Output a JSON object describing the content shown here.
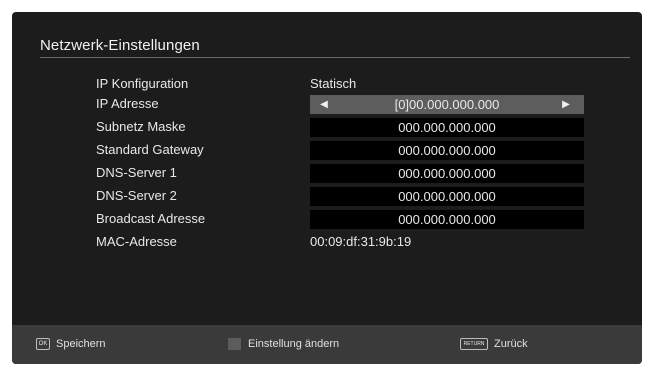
{
  "panel": {
    "title": "Netzwerk-Einstellungen"
  },
  "settings": [
    {
      "label": "IP Konfiguration",
      "value": "Statisch"
    },
    {
      "label": "IP Adresse",
      "value": "[0]00.000.000.000"
    },
    {
      "label": "Subnetz Maske",
      "value": "000.000.000.000"
    },
    {
      "label": "Standard Gateway",
      "value": "000.000.000.000"
    },
    {
      "label": "DNS-Server 1",
      "value": "000.000.000.000"
    },
    {
      "label": "DNS-Server 2",
      "value": "000.000.000.000"
    },
    {
      "label": "Broadcast Adresse",
      "value": "000.000.000.000"
    },
    {
      "label": "MAC-Adresse",
      "value": "00:09:df:31:9b:19"
    }
  ],
  "arrows": {
    "left": "◀",
    "right": "▶"
  },
  "footer": {
    "ok_key": "OK",
    "save_label": "Speichern",
    "change_label": "Einstellung ändern",
    "return_key": "RETURN",
    "back_label": "Zurück"
  },
  "colors": {
    "background": "#1c1c1c",
    "selected_row": "#5d5d5d",
    "value_box": "#000000",
    "footer": "#3a3a3a"
  }
}
